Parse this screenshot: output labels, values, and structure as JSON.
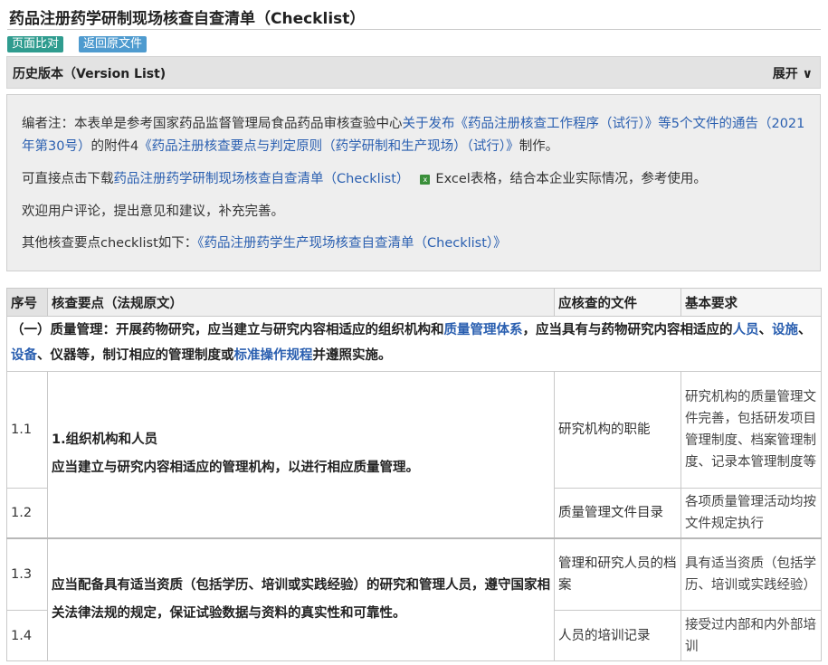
{
  "title": "药品注册药学研制现场核查自查清单（Checklist）",
  "buttons": {
    "compare": "页面比对",
    "back": "返回原文件"
  },
  "version_bar": {
    "label": "历史版本（Version List)",
    "toggle": "展开 ∨"
  },
  "note": {
    "p1_prefix": "编者注：本表单是参考国家药品监督管理局食品药品审核查验中心",
    "p1_link": "关于发布《药品注册核查工作程序（试行）》等5个文件的通告（2021年第30号）",
    "p1_mid": "的附件4",
    "p1_link2": "《药品注册核查要点与判定原则（药学研制和生产现场）（试行）》",
    "p1_suffix": "制作。",
    "p2_prefix": "可直接点击下载",
    "p2_link": "药品注册药学研制现场核查自查清单（Checklist）",
    "p2_icon": "x",
    "p2_suffix": "Excel表格，结合本企业实际情况，参考使用。",
    "p3": "欢迎用户评论，提出意见和建议，补充完善。",
    "p4_prefix": "其他核查要点checklist如下：",
    "p4_link": "《药品注册药学生产现场核查自查清单（Checklist）》"
  },
  "table": {
    "headers": {
      "idx": "序号",
      "point": "核查要点（法规原文）",
      "doc": "应核查的文件",
      "req": "基本要求"
    },
    "section": {
      "t1": "（一）质量管理：开展药物研究，应当建立与研究内容相适应的组织机构和",
      "l1": "质量管理体系",
      "t2": "，应当具有与药物研究内容相适应的",
      "l2": "人员",
      "t3": "、",
      "l3": "设施",
      "t4": "、",
      "l4": "设备",
      "t5": "、仪器等，制订相应的管理制度或",
      "l5": "标准操作规程",
      "t6": "并遵照实施。"
    },
    "group1": {
      "heading": "1.组织机构和人员",
      "text": "应当建立与研究内容相适应的管理机构，以进行相应质量管理。"
    },
    "group2": {
      "text": "应当配备具有适当资质（包括学历、培训或实践经验）的研究和管理人员，遵守国家相关法律法规的规定，保证试验数据与资料的真实性和可靠性。"
    },
    "rows": [
      {
        "idx": "1.1",
        "doc": "研究机构的职能",
        "req": "研究机构的质量管理文件完善，包括研发项目管理制度、档案管理制度、记录本管理制度等"
      },
      {
        "idx": "1.2",
        "doc": "质量管理文件目录",
        "req": "各项质量管理活动均按文件规定执行"
      },
      {
        "idx": "1.3",
        "doc": "管理和研究人员的档案",
        "req": "具有适当资质（包括学历、培训或实践经验）"
      },
      {
        "idx": "1.4",
        "doc": "人员的培训记录",
        "req": "接受过内部和内外部培训"
      }
    ]
  }
}
